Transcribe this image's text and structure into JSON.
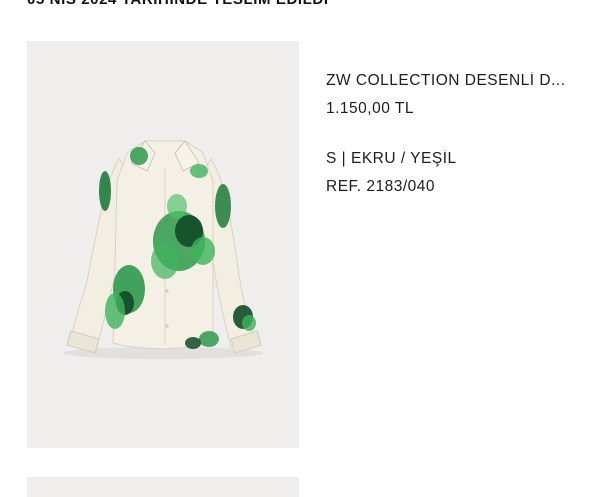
{
  "order": {
    "delivery_status": "05 NİS 2024 TARİHİNDE TESLİM EDİLDİ"
  },
  "product": {
    "name": "ZW COLLECTION DESENLİ D...",
    "price": "1.150,00 TL",
    "variant": "S | EKRU / YEŞİL",
    "reference": "REF. 2183/040",
    "image_icon": "floral-shirt-image",
    "colors": {
      "background": "#efeeec",
      "fabric": "#f3eee2",
      "print_green": "#2e9a4b",
      "print_dark": "#124a28"
    }
  }
}
